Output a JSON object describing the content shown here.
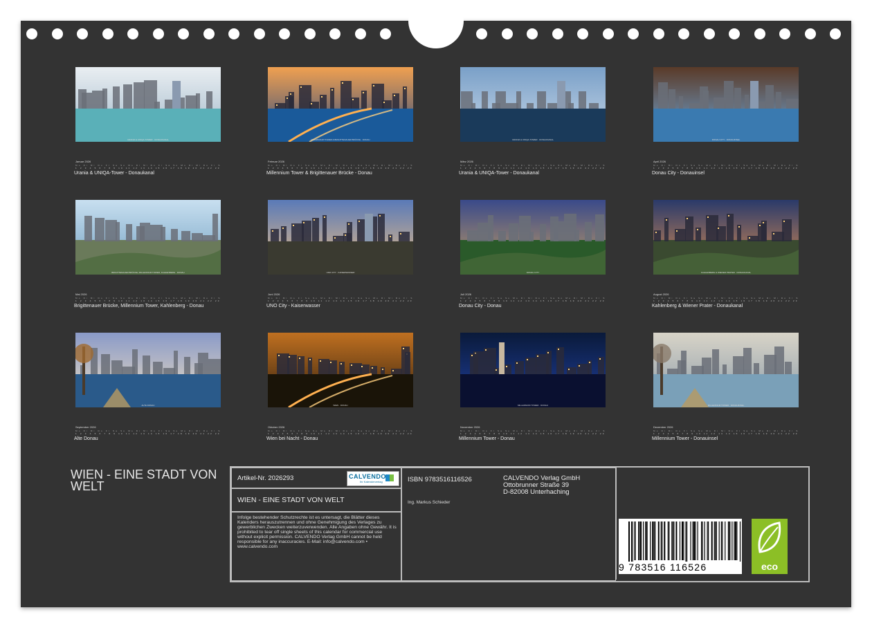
{
  "cover": {
    "title": "WIEN - EINE STADT VON WELT"
  },
  "months": [
    {
      "month": "Januar 2026",
      "title": "Urania & UNIQA-Tower - Donaukanal",
      "caption": "URANIA & UNIQA-TOWER · DONAUKANAL",
      "days": "1 2 3 4 5 6 7 8 9 10 11 12 13 14 15 16 17 18 19 20 21 22 23 24 25 26 27 28 29 30 31"
    },
    {
      "month": "Februar 2026",
      "title": "Millennium Tower & Brigittenauer Brücke - Donau",
      "caption": "MILLENNIUM TOWER & BRIGITTENAUER BRÜCKE · DONAU",
      "days": "1 2 3 4 5 6 7 8 9 10 11 12 13 14 15 16 17 18 19 20 21 22 23 24 25 26 27 28"
    },
    {
      "month": "März 2026",
      "title": "Urania & UNIQA-Tower - Donaukanal",
      "caption": "URANIA & UNIQA-TOWER · DONAUKANAL",
      "days": "1 2 3 4 5 6 7 8 9 10 11 12 13 14 15 16 17 18 19 20 21 22 23 24 25 26 27 28 29 30 31"
    },
    {
      "month": "April 2026",
      "title": "Donau City - Donauinsel",
      "caption": "DONAU CITY · DONAUINSEL",
      "days": "1 2 3 4 5 6 7 8 9 10 11 12 13 14 15 16 17 18 19 20 21 22 23 24 25 26 27 28 29 30"
    },
    {
      "month": "Mai 2026",
      "title": "Brigittenauer Brücke, Millennium Tower, Kahlenberg - Donau",
      "caption": "BRIGITTENAUER BRÜCKE, MILLENNIUM TOWER, KAHLENBERG · DONAU",
      "days": "1 2 3 4 5 6 7 8 9 10 11 12 13 14 15 16 17 18 19 20 21 22 23 24 25 26 27 28 29 30 31"
    },
    {
      "month": "Juni 2026",
      "title": "UNO City - Kaiserwasser",
      "caption": "UNO CITY · KAISERWASSER",
      "days": "1 2 3 4 5 6 7 8 9 10 11 12 13 14 15 16 17 18 19 20 21 22 23 24 25 26 27 28 29 30"
    },
    {
      "month": "Juli 2026",
      "title": "Donau City - Donau",
      "caption": "DONAU CITY",
      "days": "1 2 3 4 5 6 7 8 9 10 11 12 13 14 15 16 17 18 19 20 21 22 23 24 25 26 27 28 29 30 31"
    },
    {
      "month": "August 2026",
      "title": "Kahlenberg & Wiener Prater - Donaukanal",
      "caption": "KAHLENBERG & WIENER PRATER · DONAUKANAL",
      "days": "1 2 3 4 5 6 7 8 9 10 11 12 13 14 15 16 17 18 19 20 21 22 23 24 25 26 27 28 29 30 31"
    },
    {
      "month": "September 2026",
      "title": "Alte Donau",
      "caption": "ALTE DONAU",
      "days": "1 2 3 4 5 6 7 8 9 10 11 12 13 14 15 16 17 18 19 20 21 22 23 24 25 26 27 28 29 30"
    },
    {
      "month": "Oktober 2026",
      "title": "Wien bei Nacht - Donau",
      "caption": "WIEN · DONAU",
      "days": "1 2 3 4 5 6 7 8 9 10 11 12 13 14 15 16 17 18 19 20 21 22 23 24 25 26 27 28 29 30 31"
    },
    {
      "month": "November 2026",
      "title": "Millennium Tower - Donau",
      "caption": "MILLENNIUM TOWER · DONAU",
      "days": "1 2 3 4 5 6 7 8 9 10 11 12 13 14 15 16 17 18 19 20 21 22 23 24 25 26 27 28 29 30"
    },
    {
      "month": "Dezember 2026",
      "title": "Millennium Tower - Donauinsel",
      "caption": "MILLENNIUM TOWER · DONAUINSEL",
      "days": "1 2 3 4 5 6 7 8 9 10 11 12 13 14 15 16 17 18 19 20 21 22 23 24 25 26 27 28 29 30 31"
    }
  ],
  "daynames": "Mo Di Mi Do Fr Sa So Mo Di Mi Do Fr Sa So Mo Di Mi Do Fr Sa So Mo Di Mi Do Fr Sa So Mo Di Mi",
  "info": {
    "article": "Artikel-Nr. 2026293",
    "logo": "CALVENDO",
    "logo_sub": "Ihr Kalenderverlag",
    "title": "WIEN - EINE STADT VON WELT",
    "legal": "Infolge bestehender Schutzrechte ist es untersagt, die Blätter dieses Kalenders herauszutrennen und ohne Genehmigung des Verlages zu gewerblichen Zwecken weiterzuverwenden. Alle Angaben ohne Gewähr. It is prohibited to tear off single sheets of this calendar for commercial use without explicit permission. CALVENDO Verlag GmbH cannot be held responsible for any inaccuracies. E-Mail: info@calvendo.com • www.calvendo.com",
    "isbn": "ISBN 9783516116526",
    "author": "Ing. Markus Schieder",
    "publisher_name": "CALVENDO Verlag GmbH",
    "publisher_street": "Ottobrunner Straße 39",
    "publisher_city": "D-82008 Unterhaching",
    "barcode_text": "9  783516  116526",
    "eco_label": "eco"
  },
  "colors": {
    "background": "#333333",
    "eco_green": "#8cbf26",
    "calvendo_blue": "#0a6e9e"
  }
}
